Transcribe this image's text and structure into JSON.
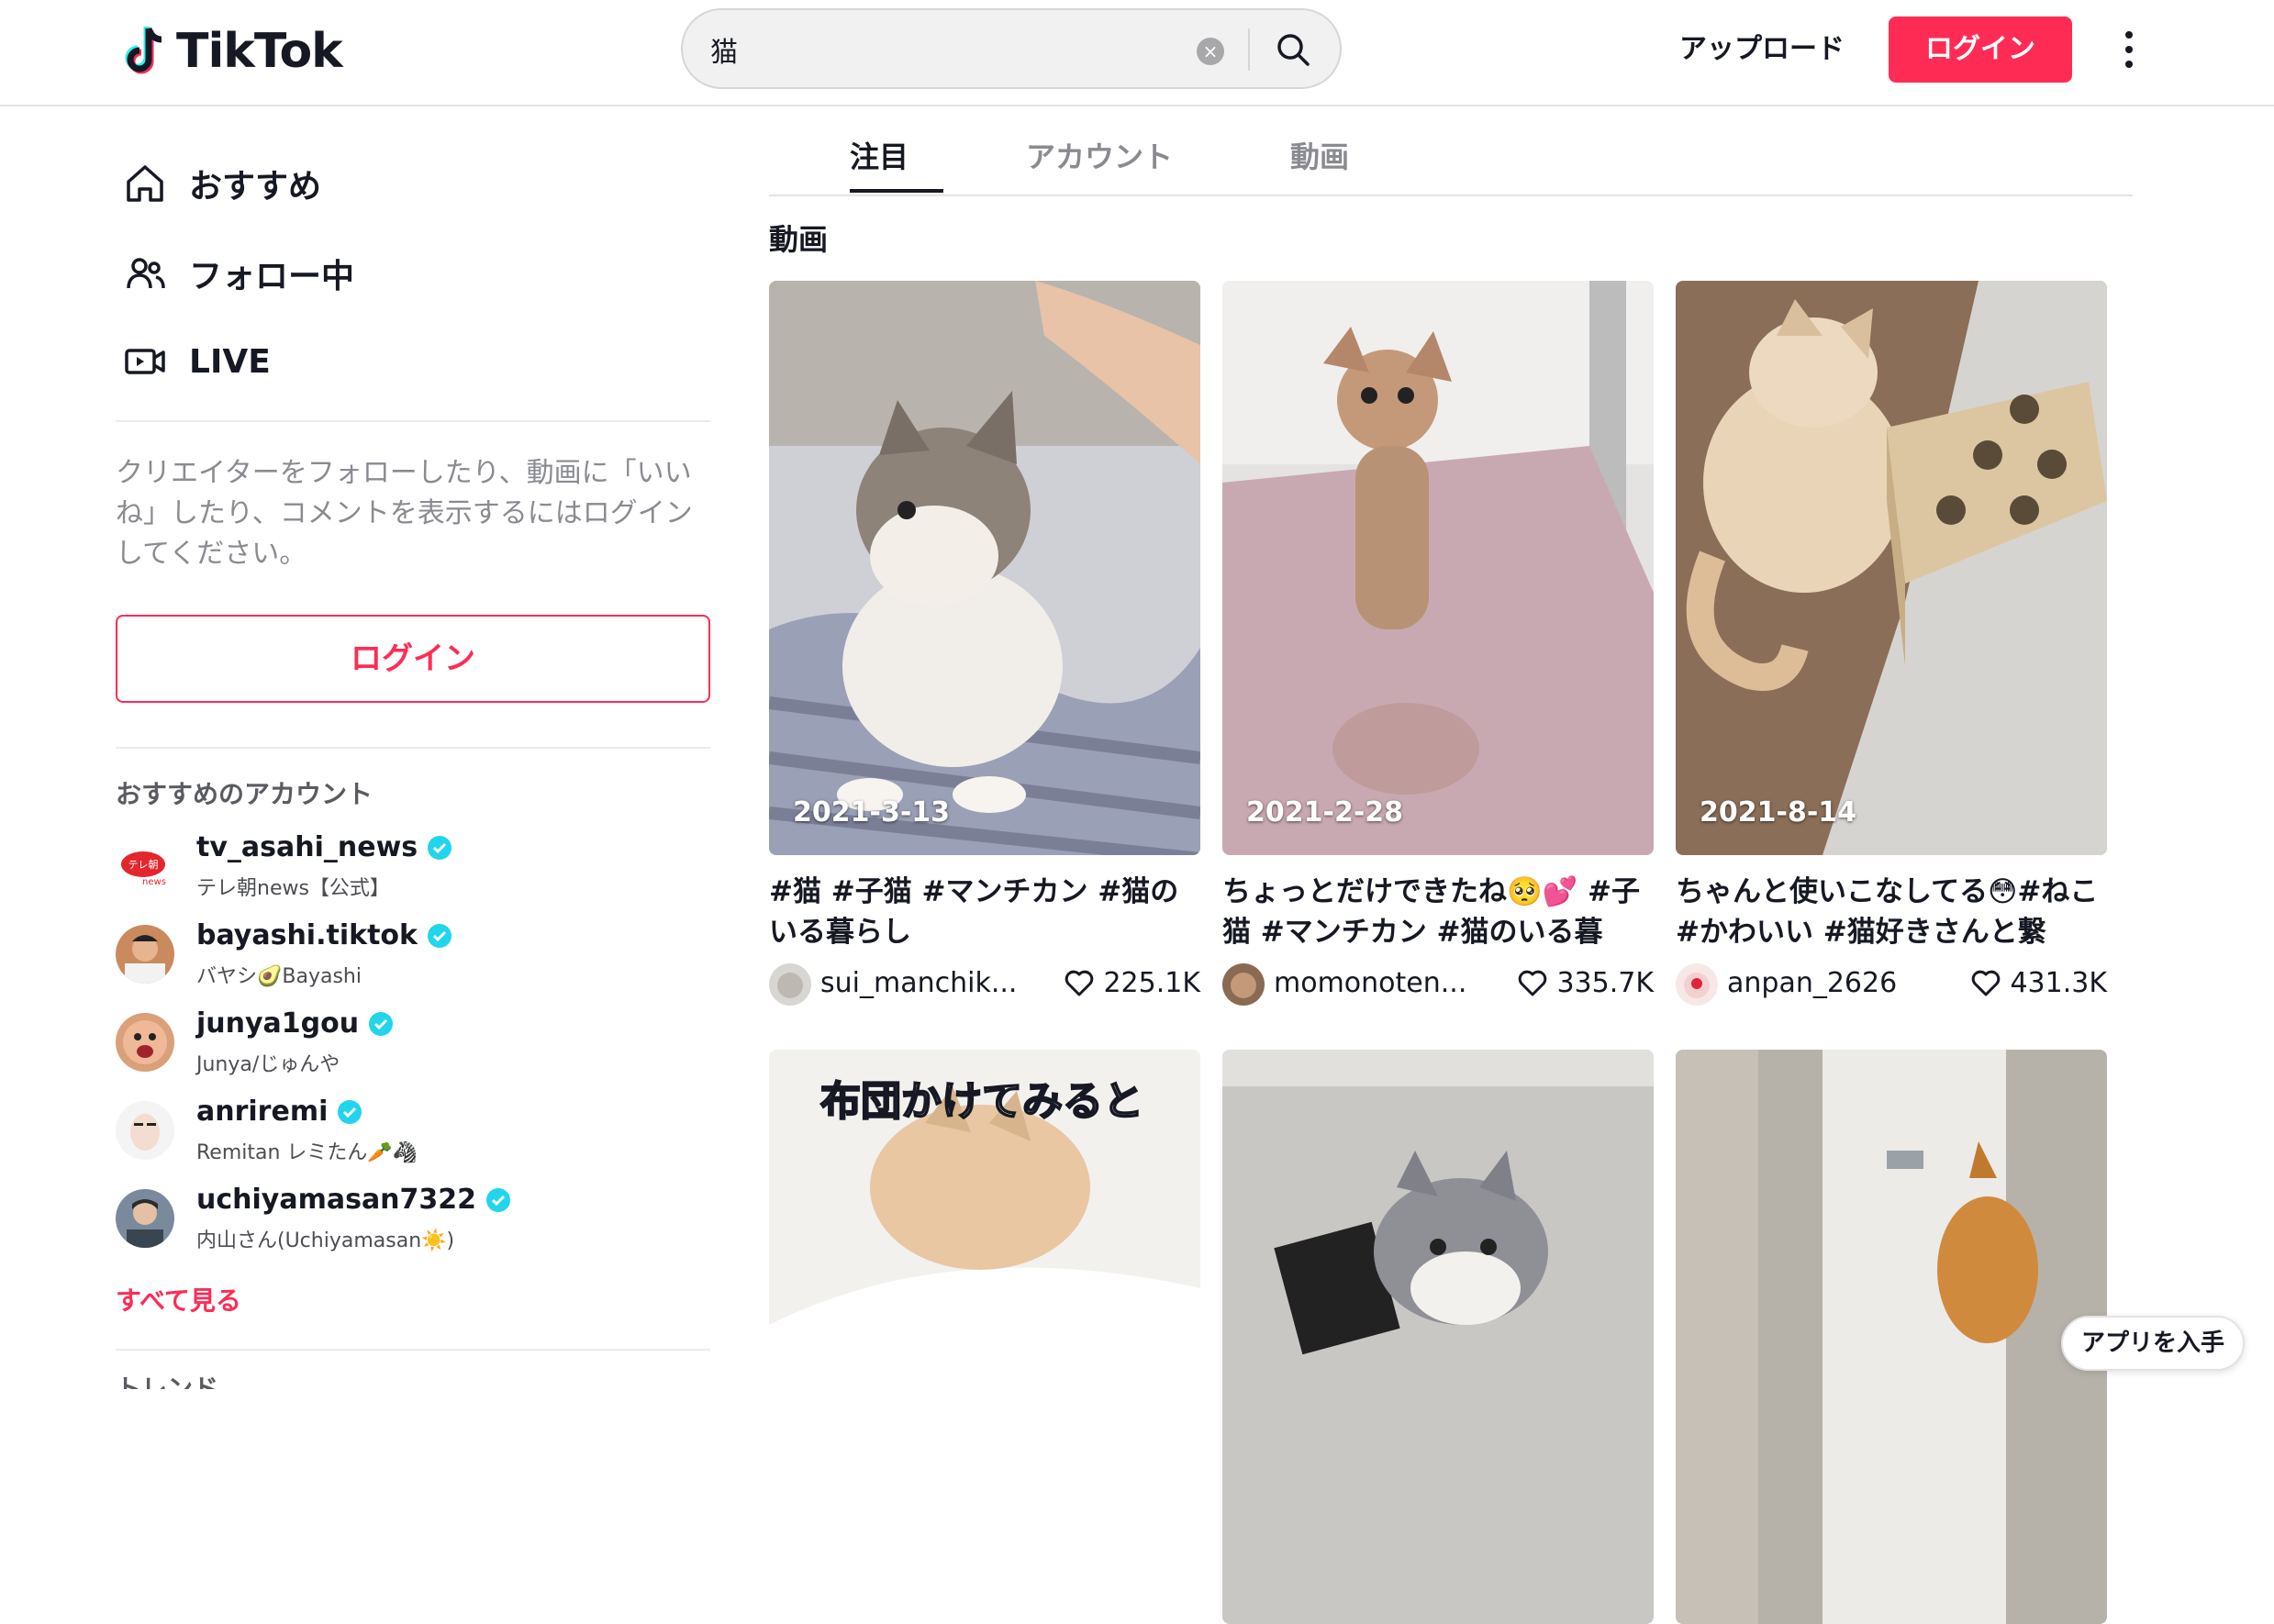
{
  "header": {
    "logo_text": "TikTok",
    "search": {
      "value": "猫",
      "clear_icon": "×"
    },
    "upload_label": "アップロード",
    "login_label": "ログイン"
  },
  "sidebar": {
    "nav": [
      {
        "label": "おすすめ",
        "icon": "home-icon"
      },
      {
        "label": "フォロー中",
        "icon": "people-icon"
      },
      {
        "label": "LIVE",
        "icon": "live-icon"
      }
    ],
    "login_hint": "クリエイターをフォローしたり、動画に「いいね」したり、コメントを表示するにはログインしてください。",
    "login_label": "ログイン",
    "suggested_title": "おすすめのアカウント",
    "accounts": [
      {
        "username": "tv_asahi_news",
        "display": "テレ朝news【公式】",
        "verified": true
      },
      {
        "username": "bayashi.tiktok",
        "display": "バヤシ🥑Bayashi",
        "verified": true
      },
      {
        "username": "junya1gou",
        "display": "Junya/じゅんや",
        "verified": true
      },
      {
        "username": "anriremi",
        "display": "Remitan レミたん🥕🦓",
        "verified": true
      },
      {
        "username": "uchiyamasan7322",
        "display": "内山さん(Uchiyamasan☀️)",
        "verified": true
      }
    ],
    "see_all": "すべて見る",
    "trending_label": "トレンド"
  },
  "main": {
    "tabs": [
      {
        "label": "注目",
        "active": true
      },
      {
        "label": "アカウント",
        "active": false
      },
      {
        "label": "動画",
        "active": false
      }
    ],
    "section_title": "動画",
    "videos": [
      {
        "date": "2021-3-13",
        "caption": "#猫 #子猫 #マンチカン #猫のいる暮らし",
        "user": "sui_manchik...",
        "likes": "225.1K"
      },
      {
        "date": "2021-2-28",
        "caption": "ちょっとだけできたね🥺💕 #子猫 #マンチカン #猫のいる暮ら...",
        "user": "momonoten...",
        "likes": "335.7K"
      },
      {
        "date": "2021-8-14",
        "caption": "ちゃんと使いこなしてる😳#ねこ #かわいい #猫好きさんと繋が...",
        "user": "anpan_2626",
        "likes": "431.3K"
      },
      {
        "overlay_text": "布団かけてみると"
      },
      {},
      {}
    ]
  },
  "get_app_label": "アプリを入手",
  "colors": {
    "brand": "#fe2c55",
    "verified": "#20d5ec"
  }
}
